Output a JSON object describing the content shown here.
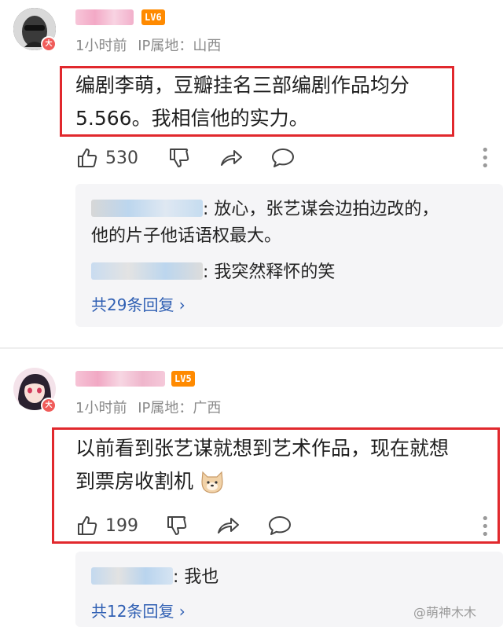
{
  "comments": [
    {
      "level": "LV6",
      "verified_badge": "大",
      "time": "1小时前",
      "ip_location": "IP属地：山西",
      "text_line1": "编剧李萌，豆瓣挂名三部编剧作品均分",
      "text_line2": "5.566。我相信他的实力。",
      "likes": "530",
      "replies": [
        {
          "text_line1": ": 放心，张艺谋会边拍边改的，",
          "text_line2": "他的片子他话语权最大。"
        },
        {
          "text_line1": ": 我突然释怀的笑"
        }
      ],
      "more_replies": "共29条回复 ›"
    },
    {
      "level": "LV5",
      "verified_badge": "大",
      "time": "1小时前",
      "ip_location": "IP属地：广西",
      "text_line1": "以前看到张艺谋就想到艺术作品，现在就想",
      "text_line2": "到票房收割机",
      "likes": "199",
      "replies": [
        {
          "text_line1": ": 我也"
        }
      ],
      "more_replies": "共12条回复 ›"
    }
  ],
  "watermark": "@萌神木木",
  "colors": {
    "highlight_box": "#e1282d",
    "level_badge": "#ff8a00",
    "link": "#2f5fb3",
    "verified": "#f05b59"
  }
}
